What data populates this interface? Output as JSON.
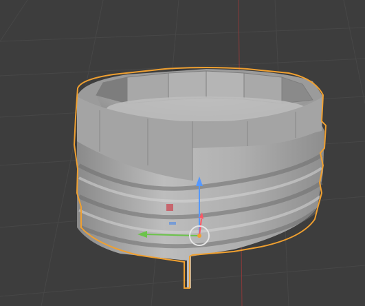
{
  "viewport": {
    "background_color": "#3d3d3d",
    "grid_line_color": "#474747",
    "axis_red_color": "#8a3a3a"
  },
  "selected_object": {
    "type": "threaded cylinder cap mesh",
    "outline_color": "#f0a030",
    "base_color": "#a6a6a6",
    "selected": true
  },
  "gizmo": {
    "x_arrow_color": "#6bc34a",
    "y_arrow_color": "#ff5566",
    "z_arrow_color": "#5598ff",
    "origin_color": "#f0a030"
  },
  "icons": {
    "origin": "origin-dot-icon",
    "transform": "transform-gizmo-icon"
  }
}
